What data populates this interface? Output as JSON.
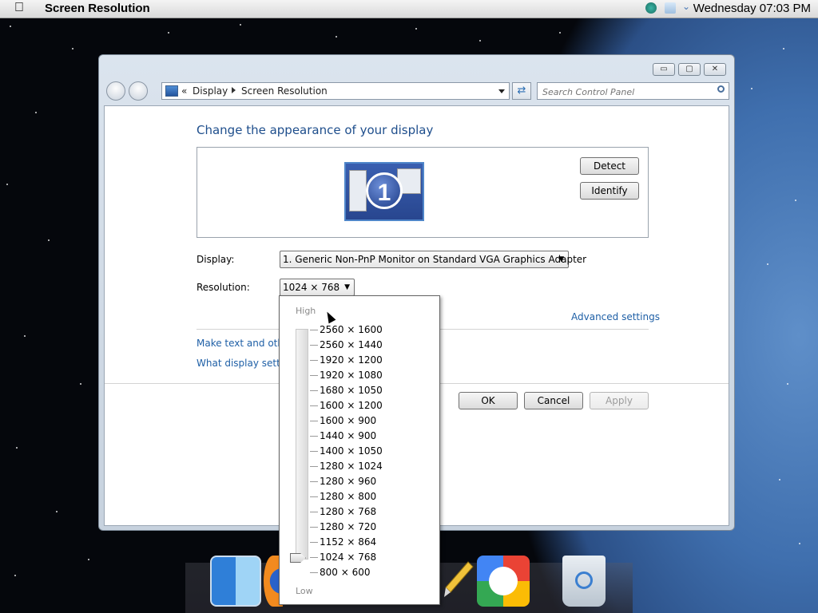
{
  "menubar": {
    "apple_icon": "apple-icon",
    "app_title": "Screen Resolution",
    "clock": "Wednesday 07:03 PM"
  },
  "window": {
    "caption_buttons": {
      "minimize": "▭",
      "maximize": "▢",
      "close": "✕"
    },
    "address": {
      "prefix": "«",
      "crumbs": [
        "Display",
        "Screen Resolution"
      ]
    },
    "search_placeholder": "Search Control Panel",
    "title": "Change the appearance of your display",
    "monitor_number": "1",
    "detect_label": "Detect",
    "identify_label": "Identify",
    "display_label": "Display:",
    "display_value": "1. Generic Non-PnP Monitor on Standard VGA Graphics Adapter",
    "resolution_label": "Resolution:",
    "resolution_value": "1024 × 768",
    "advanced_link": "Advanced settings",
    "text_link": "Make text and other items larger or smaller",
    "what_link": "What display settings should I choose?",
    "ok_label": "OK",
    "cancel_label": "Cancel",
    "apply_label": "Apply"
  },
  "resolution_popup": {
    "high_label": "High",
    "low_label": "Low",
    "options": [
      "2560 × 1600",
      "2560 × 1440",
      "1920 × 1200",
      "1920 × 1080",
      "1680 × 1050",
      "1600 × 1200",
      "1600 × 900",
      "1440 × 900",
      "1400 × 1050",
      "1280 × 1024",
      "1280 × 960",
      "1280 × 800",
      "1280 × 768",
      "1280 × 720",
      "1152 × 864",
      "1024 × 768",
      "800 × 600"
    ],
    "selected_index": 15
  },
  "dock": {
    "icons": [
      "finder-icon",
      "firefox-icon",
      "tool-icon",
      "google-icon",
      "recycle-bin-icon"
    ]
  }
}
